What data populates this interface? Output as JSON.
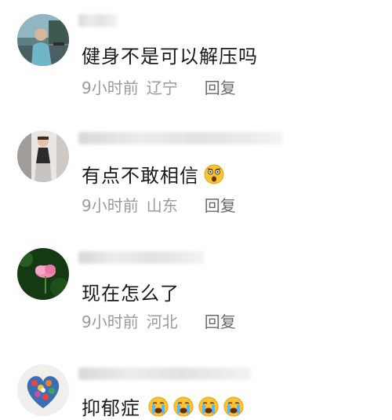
{
  "comments": [
    {
      "text": "健身不是可以解压吗",
      "time": "9小时前",
      "location": "辽宁",
      "reply_label": "回复",
      "emojis": []
    },
    {
      "text": "有点不敢相信",
      "time": "9小时前",
      "location": "山东",
      "reply_label": "回复",
      "emojis": [
        "astonished-face-emoji"
      ]
    },
    {
      "text": "现在怎么了",
      "time": "9小时前",
      "location": "河北",
      "reply_label": "回复",
      "emojis": []
    },
    {
      "text": "抑郁症",
      "emojis": [
        "crying-face-emoji",
        "crying-face-emoji",
        "crying-face-emoji",
        "crying-face-emoji"
      ]
    }
  ],
  "colors": {
    "text": "#1a1a1a",
    "meta": "#9a9a9a",
    "reply": "#6a6a6a",
    "emoji_yellow": "#f7c531"
  }
}
